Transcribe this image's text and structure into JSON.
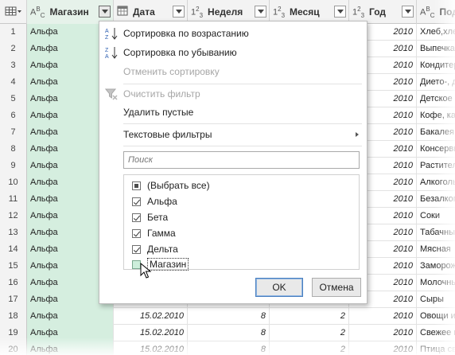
{
  "header": {
    "columns": [
      {
        "type_icon": "table-icon",
        "label": ""
      },
      {
        "type_icon": "ABC",
        "label": "Магазин"
      },
      {
        "type_icon": "calendar-icon",
        "label": "Дата"
      },
      {
        "type_icon": "123",
        "label": "Неделя"
      },
      {
        "type_icon": "123",
        "label": "Месяц"
      },
      {
        "type_icon": "123",
        "label": "Год"
      },
      {
        "type_icon": "ABC",
        "label": "Под"
      }
    ]
  },
  "rows": [
    {
      "n": "1",
      "shop": "Альфа",
      "date": "",
      "week": "",
      "month": "",
      "year": "2010",
      "prod": "Хлеб,хлебо"
    },
    {
      "n": "2",
      "shop": "Альфа",
      "date": "",
      "week": "",
      "month": "",
      "year": "2010",
      "prod": "Выпечка"
    },
    {
      "n": "3",
      "shop": "Альфа",
      "date": "",
      "week": "",
      "month": "",
      "year": "2010",
      "prod": "Кондитерс"
    },
    {
      "n": "4",
      "shop": "Альфа",
      "date": "",
      "week": "",
      "month": "",
      "year": "2010",
      "prod": "Диетo-, д"
    },
    {
      "n": "5",
      "shop": "Альфа",
      "date": "",
      "week": "",
      "month": "",
      "year": "2010",
      "prod": "Детское"
    },
    {
      "n": "6",
      "shop": "Альфа",
      "date": "",
      "week": "",
      "month": "",
      "year": "2010",
      "prod": "Кофе, ка"
    },
    {
      "n": "7",
      "shop": "Альфа",
      "date": "",
      "week": "",
      "month": "",
      "year": "2010",
      "prod": "Бакалея"
    },
    {
      "n": "8",
      "shop": "Альфа",
      "date": "",
      "week": "",
      "month": "",
      "year": "2010",
      "prod": "Консервы"
    },
    {
      "n": "9",
      "shop": "Альфа",
      "date": "",
      "week": "",
      "month": "",
      "year": "2010",
      "prod": "Растител"
    },
    {
      "n": "10",
      "shop": "Альфа",
      "date": "",
      "week": "",
      "month": "",
      "year": "2010",
      "prod": "Алкоголь"
    },
    {
      "n": "11",
      "shop": "Альфа",
      "date": "",
      "week": "",
      "month": "",
      "year": "2010",
      "prod": "Безалког"
    },
    {
      "n": "12",
      "shop": "Альфа",
      "date": "",
      "week": "",
      "month": "",
      "year": "2010",
      "prod": "Соки"
    },
    {
      "n": "13",
      "shop": "Альфа",
      "date": "",
      "week": "",
      "month": "",
      "year": "2010",
      "prod": "Табачные"
    },
    {
      "n": "14",
      "shop": "Альфа",
      "date": "",
      "week": "",
      "month": "",
      "year": "2010",
      "prod": "Мясная"
    },
    {
      "n": "15",
      "shop": "Альфа",
      "date": "",
      "week": "",
      "month": "",
      "year": "2010",
      "prod": "Заморож"
    },
    {
      "n": "16",
      "shop": "Альфа",
      "date": "",
      "week": "",
      "month": "",
      "year": "2010",
      "prod": "Молочные"
    },
    {
      "n": "17",
      "shop": "Альфа",
      "date": "",
      "week": "",
      "month": "",
      "year": "2010",
      "prod": "Сыры"
    },
    {
      "n": "18",
      "shop": "Альфа",
      "date": "15.02.2010",
      "week": "8",
      "month": "2",
      "year": "2010",
      "prod": "Овощи и"
    },
    {
      "n": "19",
      "shop": "Альфа",
      "date": "15.02.2010",
      "week": "8",
      "month": "2",
      "year": "2010",
      "prod": "Свежее м"
    },
    {
      "n": "20",
      "shop": "Альфа",
      "date": "15.02.2010",
      "week": "8",
      "month": "2",
      "year": "2010",
      "prod": "Птица св"
    }
  ],
  "menu": {
    "sort_asc": "Сортировка по возрастанию",
    "sort_desc": "Сортировка по убыванию",
    "cancel_sort": "Отменить сортировку",
    "clear_filter": "Очистить фильтр",
    "remove_empty": "Удалить пустые",
    "text_filters": "Текстовые фильтры",
    "search_placeholder": "Поиск",
    "list": [
      {
        "label": "(Выбрать все)",
        "state": "partial"
      },
      {
        "label": "Альфа",
        "state": "checked"
      },
      {
        "label": "Бета",
        "state": "checked"
      },
      {
        "label": "Гамма",
        "state": "checked"
      },
      {
        "label": "Дельта",
        "state": "checked"
      },
      {
        "label": "Магазин",
        "state": "unchecked"
      }
    ],
    "ok_label": "OK",
    "cancel_label": "Отмена"
  },
  "colors": {
    "selected_column": "#d5eedf",
    "header_bg": "#f3f3f3",
    "ok_border": "#4a7fbf"
  }
}
